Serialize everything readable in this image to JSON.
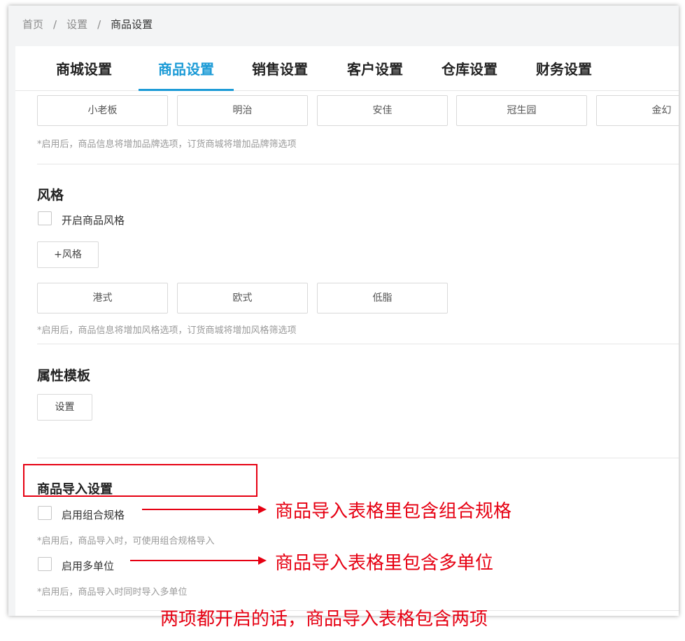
{
  "breadcrumb": {
    "items": [
      "首页",
      "设置",
      "商品设置"
    ],
    "separator": "/"
  },
  "tabs": [
    {
      "label": "商城设置",
      "active": false
    },
    {
      "label": "商品设置",
      "active": true
    },
    {
      "label": "销售设置",
      "active": false
    },
    {
      "label": "客户设置",
      "active": false
    },
    {
      "label": "仓库设置",
      "active": false
    },
    {
      "label": "财务设置",
      "active": false
    }
  ],
  "brand": {
    "chips": [
      "小老板",
      "明治",
      "安佳",
      "冠生园",
      "金幻"
    ],
    "hint": "*启用后，商品信息将增加品牌选项，订货商城将增加品牌筛选项"
  },
  "style": {
    "title": "风格",
    "checkbox_label": "开启商品风格",
    "add_button": "+风格",
    "chips": [
      "港式",
      "欧式",
      "低脂"
    ],
    "hint": "*启用后，商品信息将增加风格选项，订货商城将增加风格筛选项"
  },
  "attribute_template": {
    "title": "属性模板",
    "button": "设置"
  },
  "import_settings": {
    "title": "商品导入设置",
    "combo_spec_label": "启用组合规格",
    "combo_spec_hint": "*启用后，商品导入时，可使用组合规格导入",
    "multi_unit_label": "启用多单位",
    "multi_unit_hint": "*启用后，商品导入时同时导入多单位"
  },
  "annotations": {
    "combo_spec_note": "商品导入表格里包含组合规格",
    "multi_unit_note": "商品导入表格里包含多单位",
    "bottom_note": "两项都开启的话，商品导入表格包含两项"
  },
  "colors": {
    "accent": "#1a9ad6",
    "annotation": "#e60012"
  }
}
